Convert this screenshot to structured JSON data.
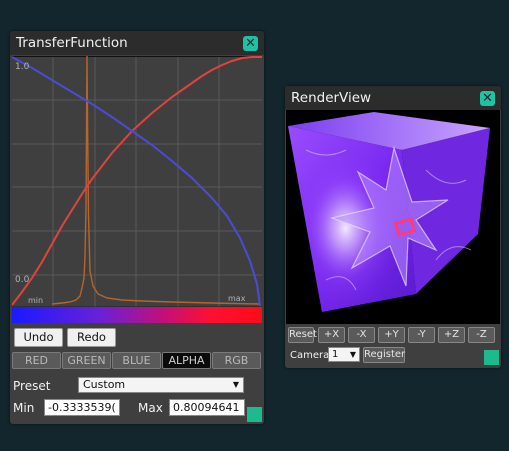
{
  "transfer_function": {
    "title": "TransferFunction",
    "close_glyph": "✕",
    "plot": {
      "y_max_label": "1.0",
      "y_min_label": "0.0",
      "x_min_label": "min",
      "x_max_label": "max"
    },
    "undo_label": "Undo",
    "redo_label": "Redo",
    "channels": [
      "RED",
      "GREEN",
      "BLUE",
      "ALPHA",
      "RGB"
    ],
    "active_channel": "ALPHA",
    "preset_label": "Preset",
    "preset_value": "Custom",
    "min_label": "Min",
    "min_value": "-0.3333539(",
    "max_label": "Max",
    "max_value": "0.80094641",
    "accent_color": "#1db98f"
  },
  "render_view": {
    "title": "RenderView",
    "close_glyph": "✕",
    "view_buttons": [
      "Reset",
      "+X",
      "-X",
      "+Y",
      "-Y",
      "+Z",
      "-Z"
    ],
    "camera_label": "Camera:",
    "camera_value": "1",
    "register_label": "Register"
  },
  "colors": {
    "background": "#13262d",
    "close_button": "#1dc3a6",
    "red_curve": "#e0433d",
    "blue_curve": "#4b4bd6",
    "histogram": "#b8642e"
  }
}
